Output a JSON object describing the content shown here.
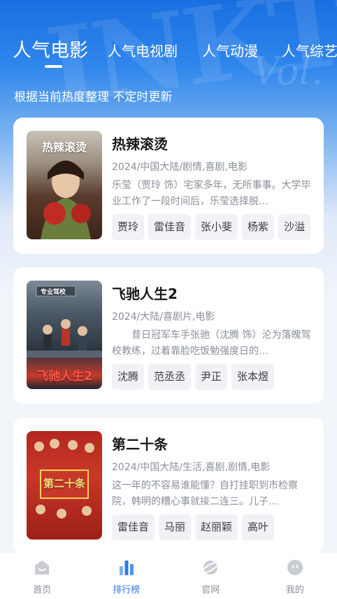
{
  "tabs": [
    {
      "label": "人气电影",
      "active": true
    },
    {
      "label": "人气电视剧",
      "active": false
    },
    {
      "label": "人气动漫",
      "active": false
    },
    {
      "label": "人气综艺",
      "active": false
    }
  ],
  "subtitle": "根据当前热度整理 不定时更新",
  "cards": [
    {
      "title": "热辣滚烫",
      "meta": "2024/中国大陆/剧情,喜剧,电影",
      "desc": "乐莹（贾玲 饰）宅家多年，无所事事。大学毕业工作了一段时间后，乐莹选择脱…",
      "tags": [
        "贾玲",
        "雷佳音",
        "张小斐",
        "杨紫",
        "沙溢"
      ],
      "poster_text": "热辣滚烫"
    },
    {
      "title": "飞驰人生2",
      "meta": "2024/大陆/喜剧片,电影",
      "desc": "　　昔日冠军车手张驰（沈腾 饰）沦为落魄驾校教练，过着靠脸吃饭勉强度日的…",
      "tags": [
        "沈腾",
        "范丞丞",
        "尹正",
        "张本煜"
      ],
      "poster_text": "飞驰人生2",
      "poster_sign": "专业驾校"
    },
    {
      "title": "第二十条",
      "meta": "2024/中国大陆/生活,喜剧,剧情,电影",
      "desc": "这一年的不容易谁能懂？自打挂职到市检察院，韩明的糟心事就接二连三。儿子…",
      "tags": [
        "雷佳音",
        "马丽",
        "赵丽颖",
        "高叶"
      ],
      "poster_text": "第二十条"
    }
  ],
  "bottom_nav": [
    {
      "label": "首页",
      "icon": "home-icon",
      "active": false
    },
    {
      "label": "排行榜",
      "icon": "ranking-icon",
      "active": true
    },
    {
      "label": "官网",
      "icon": "planet-icon",
      "active": false
    },
    {
      "label": "我的",
      "icon": "profile-icon",
      "active": false
    }
  ],
  "colors": {
    "accent": "#2a7be6",
    "header": "#1a6fe0",
    "muted": "#8a8f99"
  }
}
